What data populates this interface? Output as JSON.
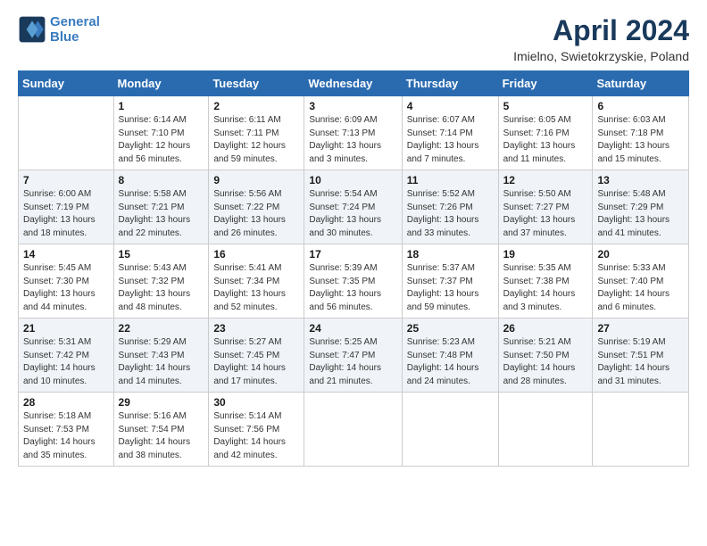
{
  "logo": {
    "line1": "General",
    "line2": "Blue"
  },
  "title": "April 2024",
  "location": "Imielno, Swietokrzyskie, Poland",
  "days_header": [
    "Sunday",
    "Monday",
    "Tuesday",
    "Wednesday",
    "Thursday",
    "Friday",
    "Saturday"
  ],
  "weeks": [
    [
      {
        "num": "",
        "info": ""
      },
      {
        "num": "1",
        "info": "Sunrise: 6:14 AM\nSunset: 7:10 PM\nDaylight: 12 hours\nand 56 minutes."
      },
      {
        "num": "2",
        "info": "Sunrise: 6:11 AM\nSunset: 7:11 PM\nDaylight: 12 hours\nand 59 minutes."
      },
      {
        "num": "3",
        "info": "Sunrise: 6:09 AM\nSunset: 7:13 PM\nDaylight: 13 hours\nand 3 minutes."
      },
      {
        "num": "4",
        "info": "Sunrise: 6:07 AM\nSunset: 7:14 PM\nDaylight: 13 hours\nand 7 minutes."
      },
      {
        "num": "5",
        "info": "Sunrise: 6:05 AM\nSunset: 7:16 PM\nDaylight: 13 hours\nand 11 minutes."
      },
      {
        "num": "6",
        "info": "Sunrise: 6:03 AM\nSunset: 7:18 PM\nDaylight: 13 hours\nand 15 minutes."
      }
    ],
    [
      {
        "num": "7",
        "info": "Sunrise: 6:00 AM\nSunset: 7:19 PM\nDaylight: 13 hours\nand 18 minutes."
      },
      {
        "num": "8",
        "info": "Sunrise: 5:58 AM\nSunset: 7:21 PM\nDaylight: 13 hours\nand 22 minutes."
      },
      {
        "num": "9",
        "info": "Sunrise: 5:56 AM\nSunset: 7:22 PM\nDaylight: 13 hours\nand 26 minutes."
      },
      {
        "num": "10",
        "info": "Sunrise: 5:54 AM\nSunset: 7:24 PM\nDaylight: 13 hours\nand 30 minutes."
      },
      {
        "num": "11",
        "info": "Sunrise: 5:52 AM\nSunset: 7:26 PM\nDaylight: 13 hours\nand 33 minutes."
      },
      {
        "num": "12",
        "info": "Sunrise: 5:50 AM\nSunset: 7:27 PM\nDaylight: 13 hours\nand 37 minutes."
      },
      {
        "num": "13",
        "info": "Sunrise: 5:48 AM\nSunset: 7:29 PM\nDaylight: 13 hours\nand 41 minutes."
      }
    ],
    [
      {
        "num": "14",
        "info": "Sunrise: 5:45 AM\nSunset: 7:30 PM\nDaylight: 13 hours\nand 44 minutes."
      },
      {
        "num": "15",
        "info": "Sunrise: 5:43 AM\nSunset: 7:32 PM\nDaylight: 13 hours\nand 48 minutes."
      },
      {
        "num": "16",
        "info": "Sunrise: 5:41 AM\nSunset: 7:34 PM\nDaylight: 13 hours\nand 52 minutes."
      },
      {
        "num": "17",
        "info": "Sunrise: 5:39 AM\nSunset: 7:35 PM\nDaylight: 13 hours\nand 56 minutes."
      },
      {
        "num": "18",
        "info": "Sunrise: 5:37 AM\nSunset: 7:37 PM\nDaylight: 13 hours\nand 59 minutes."
      },
      {
        "num": "19",
        "info": "Sunrise: 5:35 AM\nSunset: 7:38 PM\nDaylight: 14 hours\nand 3 minutes."
      },
      {
        "num": "20",
        "info": "Sunrise: 5:33 AM\nSunset: 7:40 PM\nDaylight: 14 hours\nand 6 minutes."
      }
    ],
    [
      {
        "num": "21",
        "info": "Sunrise: 5:31 AM\nSunset: 7:42 PM\nDaylight: 14 hours\nand 10 minutes."
      },
      {
        "num": "22",
        "info": "Sunrise: 5:29 AM\nSunset: 7:43 PM\nDaylight: 14 hours\nand 14 minutes."
      },
      {
        "num": "23",
        "info": "Sunrise: 5:27 AM\nSunset: 7:45 PM\nDaylight: 14 hours\nand 17 minutes."
      },
      {
        "num": "24",
        "info": "Sunrise: 5:25 AM\nSunset: 7:47 PM\nDaylight: 14 hours\nand 21 minutes."
      },
      {
        "num": "25",
        "info": "Sunrise: 5:23 AM\nSunset: 7:48 PM\nDaylight: 14 hours\nand 24 minutes."
      },
      {
        "num": "26",
        "info": "Sunrise: 5:21 AM\nSunset: 7:50 PM\nDaylight: 14 hours\nand 28 minutes."
      },
      {
        "num": "27",
        "info": "Sunrise: 5:19 AM\nSunset: 7:51 PM\nDaylight: 14 hours\nand 31 minutes."
      }
    ],
    [
      {
        "num": "28",
        "info": "Sunrise: 5:18 AM\nSunset: 7:53 PM\nDaylight: 14 hours\nand 35 minutes."
      },
      {
        "num": "29",
        "info": "Sunrise: 5:16 AM\nSunset: 7:54 PM\nDaylight: 14 hours\nand 38 minutes."
      },
      {
        "num": "30",
        "info": "Sunrise: 5:14 AM\nSunset: 7:56 PM\nDaylight: 14 hours\nand 42 minutes."
      },
      {
        "num": "",
        "info": ""
      },
      {
        "num": "",
        "info": ""
      },
      {
        "num": "",
        "info": ""
      },
      {
        "num": "",
        "info": ""
      }
    ]
  ]
}
